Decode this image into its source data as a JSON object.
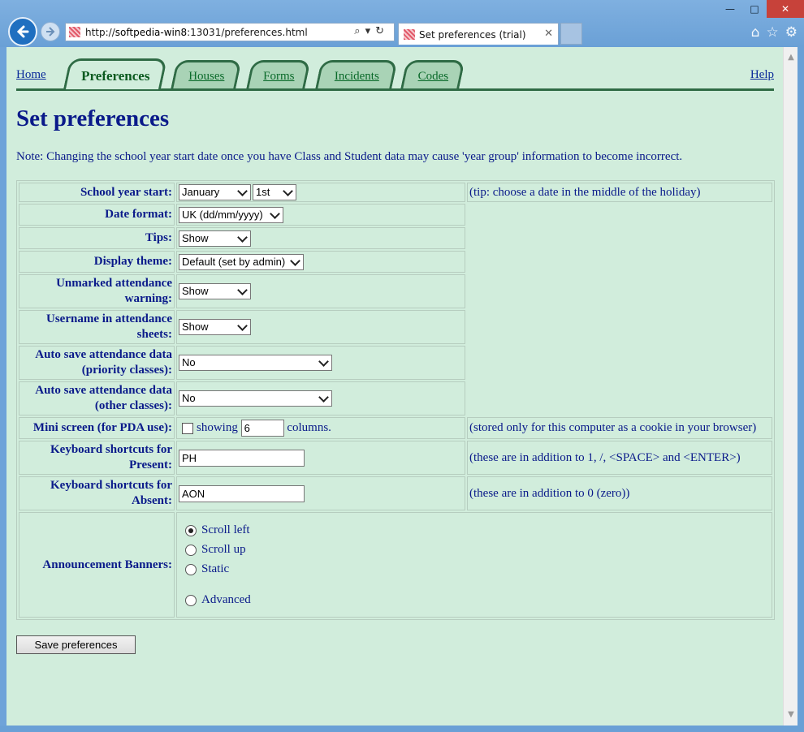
{
  "browser": {
    "url_prefix": "http://",
    "url_host": "softpedia-win8",
    "url_rest": ":13031/preferences.html",
    "tab_title": "Set preferences (trial)"
  },
  "nav": {
    "home": "Home",
    "tabs": [
      "Preferences",
      "Houses",
      "Forms",
      "Incidents",
      "Codes"
    ],
    "active_tab": "Preferences",
    "help": "Help"
  },
  "page": {
    "title": "Set preferences",
    "note": "Note: Changing the school year start date once you have Class and Student data may cause 'year group' information to become incorrect."
  },
  "form": {
    "school_year_start": {
      "label": "School year start:",
      "month": "January",
      "day": "1st",
      "tip": "(tip: choose a date in the middle of the holiday)"
    },
    "date_format": {
      "label": "Date format:",
      "value": "UK (dd/mm/yyyy)"
    },
    "tips": {
      "label": "Tips:",
      "value": "Show"
    },
    "display_theme": {
      "label": "Display theme:",
      "value": "Default (set by admin)"
    },
    "unmarked_warning": {
      "label_1": "Unmarked attendance",
      "label_2": "warning:",
      "value": "Show"
    },
    "username_sheets": {
      "label_1": "Username in attendance",
      "label_2": "sheets:",
      "value": "Show"
    },
    "autosave_priority": {
      "label_1": "Auto save attendance data",
      "label_2": "(priority classes):",
      "value": "No"
    },
    "autosave_other": {
      "label_1": "Auto save attendance data",
      "label_2": "(other classes):",
      "value": "No"
    },
    "mini_screen": {
      "label": "Mini screen (for PDA use):",
      "showing": "showing",
      "columns_value": "6",
      "columns": "columns.",
      "tip": "(stored only for this computer as a cookie in your browser)"
    },
    "kb_present": {
      "label_1": "Keyboard shortcuts for",
      "label_2": "Present:",
      "value": "PH",
      "tip": "(these are in addition to 1, /, <SPACE> and <ENTER>)"
    },
    "kb_absent": {
      "label_1": "Keyboard shortcuts for",
      "label_2": "Absent:",
      "value": "AON",
      "tip": "(these are in addition to 0 (zero))"
    },
    "banners": {
      "label": "Announcement Banners:",
      "options": [
        "Scroll left",
        "Scroll up",
        "Static",
        "Advanced"
      ],
      "selected": "Scroll left"
    }
  },
  "save_button": "Save preferences"
}
